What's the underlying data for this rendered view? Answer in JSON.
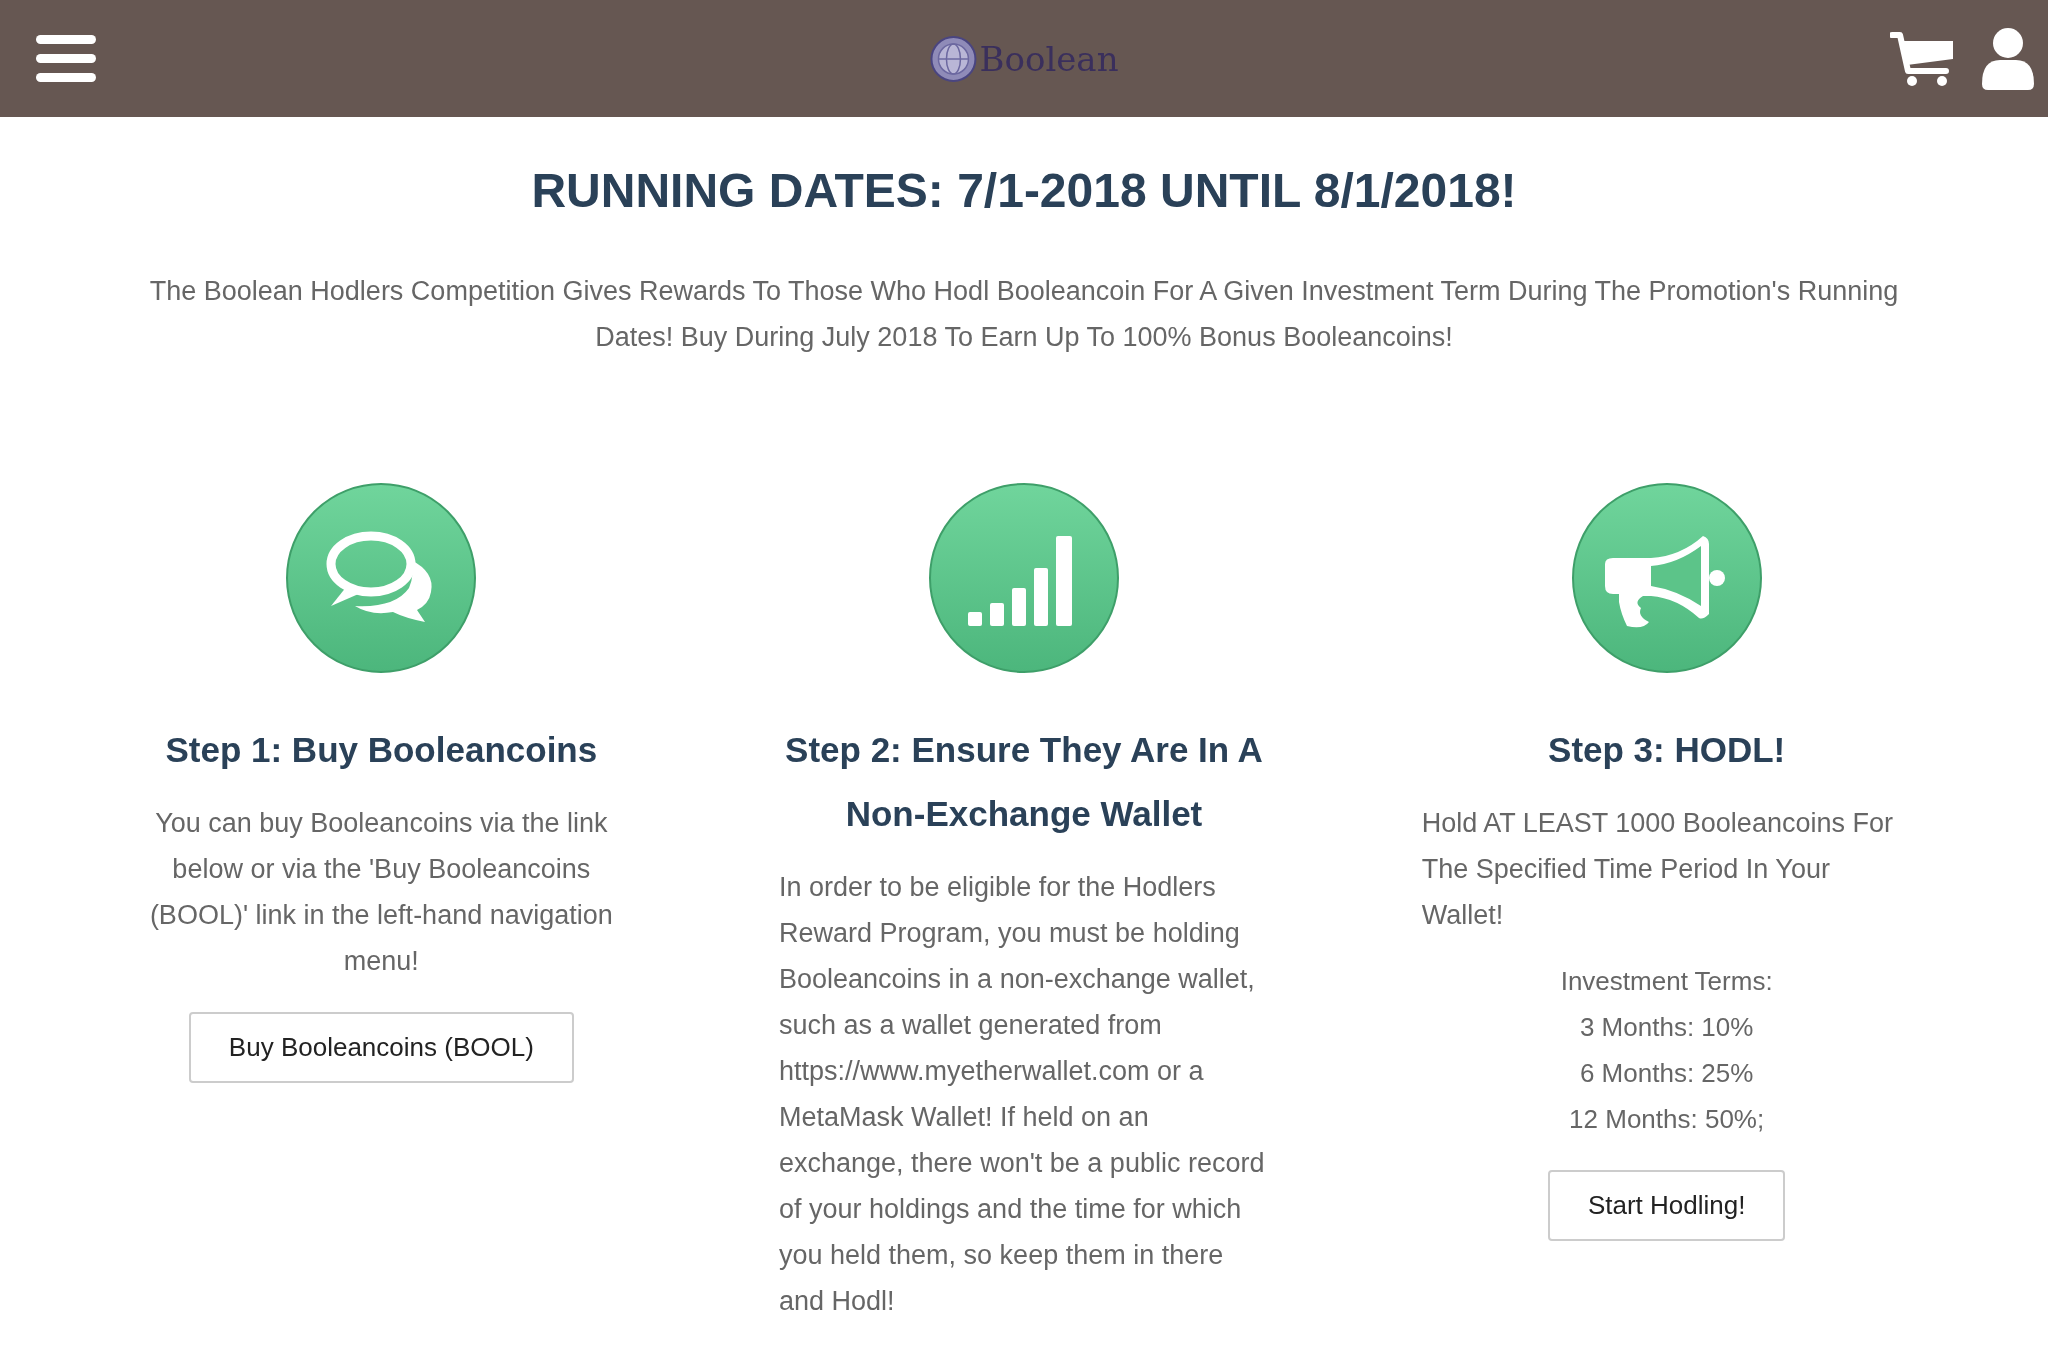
{
  "header": {
    "logo_text": "Boolean"
  },
  "title": "RUNNING DATES: 7/1-2018 UNTIL 8/1/2018!",
  "intro": "The Boolean Hodlers Competition Gives Rewards To Those Who Hodl Booleancoin For A Given Investment Term During The Promotion's Running Dates! Buy During July 2018 To Earn Up To 100% Bonus Booleancoins!",
  "steps": [
    {
      "kind": "chat",
      "heading": "Step 1: Buy Booleancoins",
      "body": "You can buy Booleancoins via the link below or via the 'Buy Booleancoins (BOOL)' link in the left-hand navigation menu!",
      "button": "Buy Booleancoins (BOOL)"
    },
    {
      "kind": "signal",
      "heading": "Step 2: Ensure They Are In A Non-Exchange Wallet",
      "body": "In order to be eligible for the Hodlers Reward Program, you must be holding Booleancoins in a non-exchange wallet, such as a wallet generated from https://www.myetherwallet.com or a MetaMask Wallet! If held on an exchange, there won't be a public record of your holdings and the time for which you held them, so keep them in there and Hodl!"
    },
    {
      "kind": "megaphone",
      "heading": "Step 3: HODL!",
      "body": "Hold AT LEAST 1000 Booleancoins For The Specified Time Period In Your Wallet!",
      "terms_title": "Investment Terms:",
      "terms": [
        "3 Months: 10%",
        "6 Months: 25%",
        "12 Months: 50%;"
      ],
      "button": "Start Hodling!"
    }
  ]
}
